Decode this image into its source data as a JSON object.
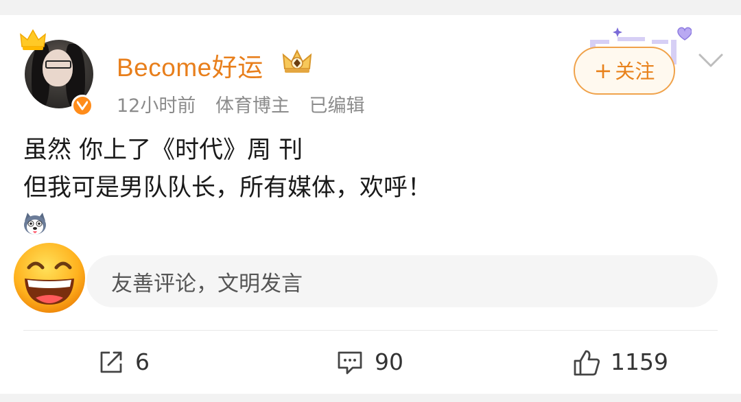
{
  "post": {
    "username": "Become好运",
    "time": "12小时前",
    "identity": "体育博主",
    "edited": "已编辑",
    "follow_label": "关注",
    "follow_plus": "+",
    "text_line1": "虽然 你上了《时代》周 刊",
    "text_line2": "但我可是男队队长，所有媒体，欢呼！"
  },
  "comment_box": {
    "placeholder": "友善评论，文明发言"
  },
  "actions": {
    "repost_count": "6",
    "comment_count": "90",
    "like_count": "1159"
  },
  "colors": {
    "username": "#e87f1c",
    "follow_border": "#f0a24a",
    "verified": "#ff8c1a"
  },
  "icons": [
    "crown-icon",
    "verified-icon",
    "rank-crown-icon",
    "chevron-down-icon",
    "husky-emoji",
    "grin-emoji",
    "repost-icon",
    "comment-icon",
    "like-icon"
  ]
}
